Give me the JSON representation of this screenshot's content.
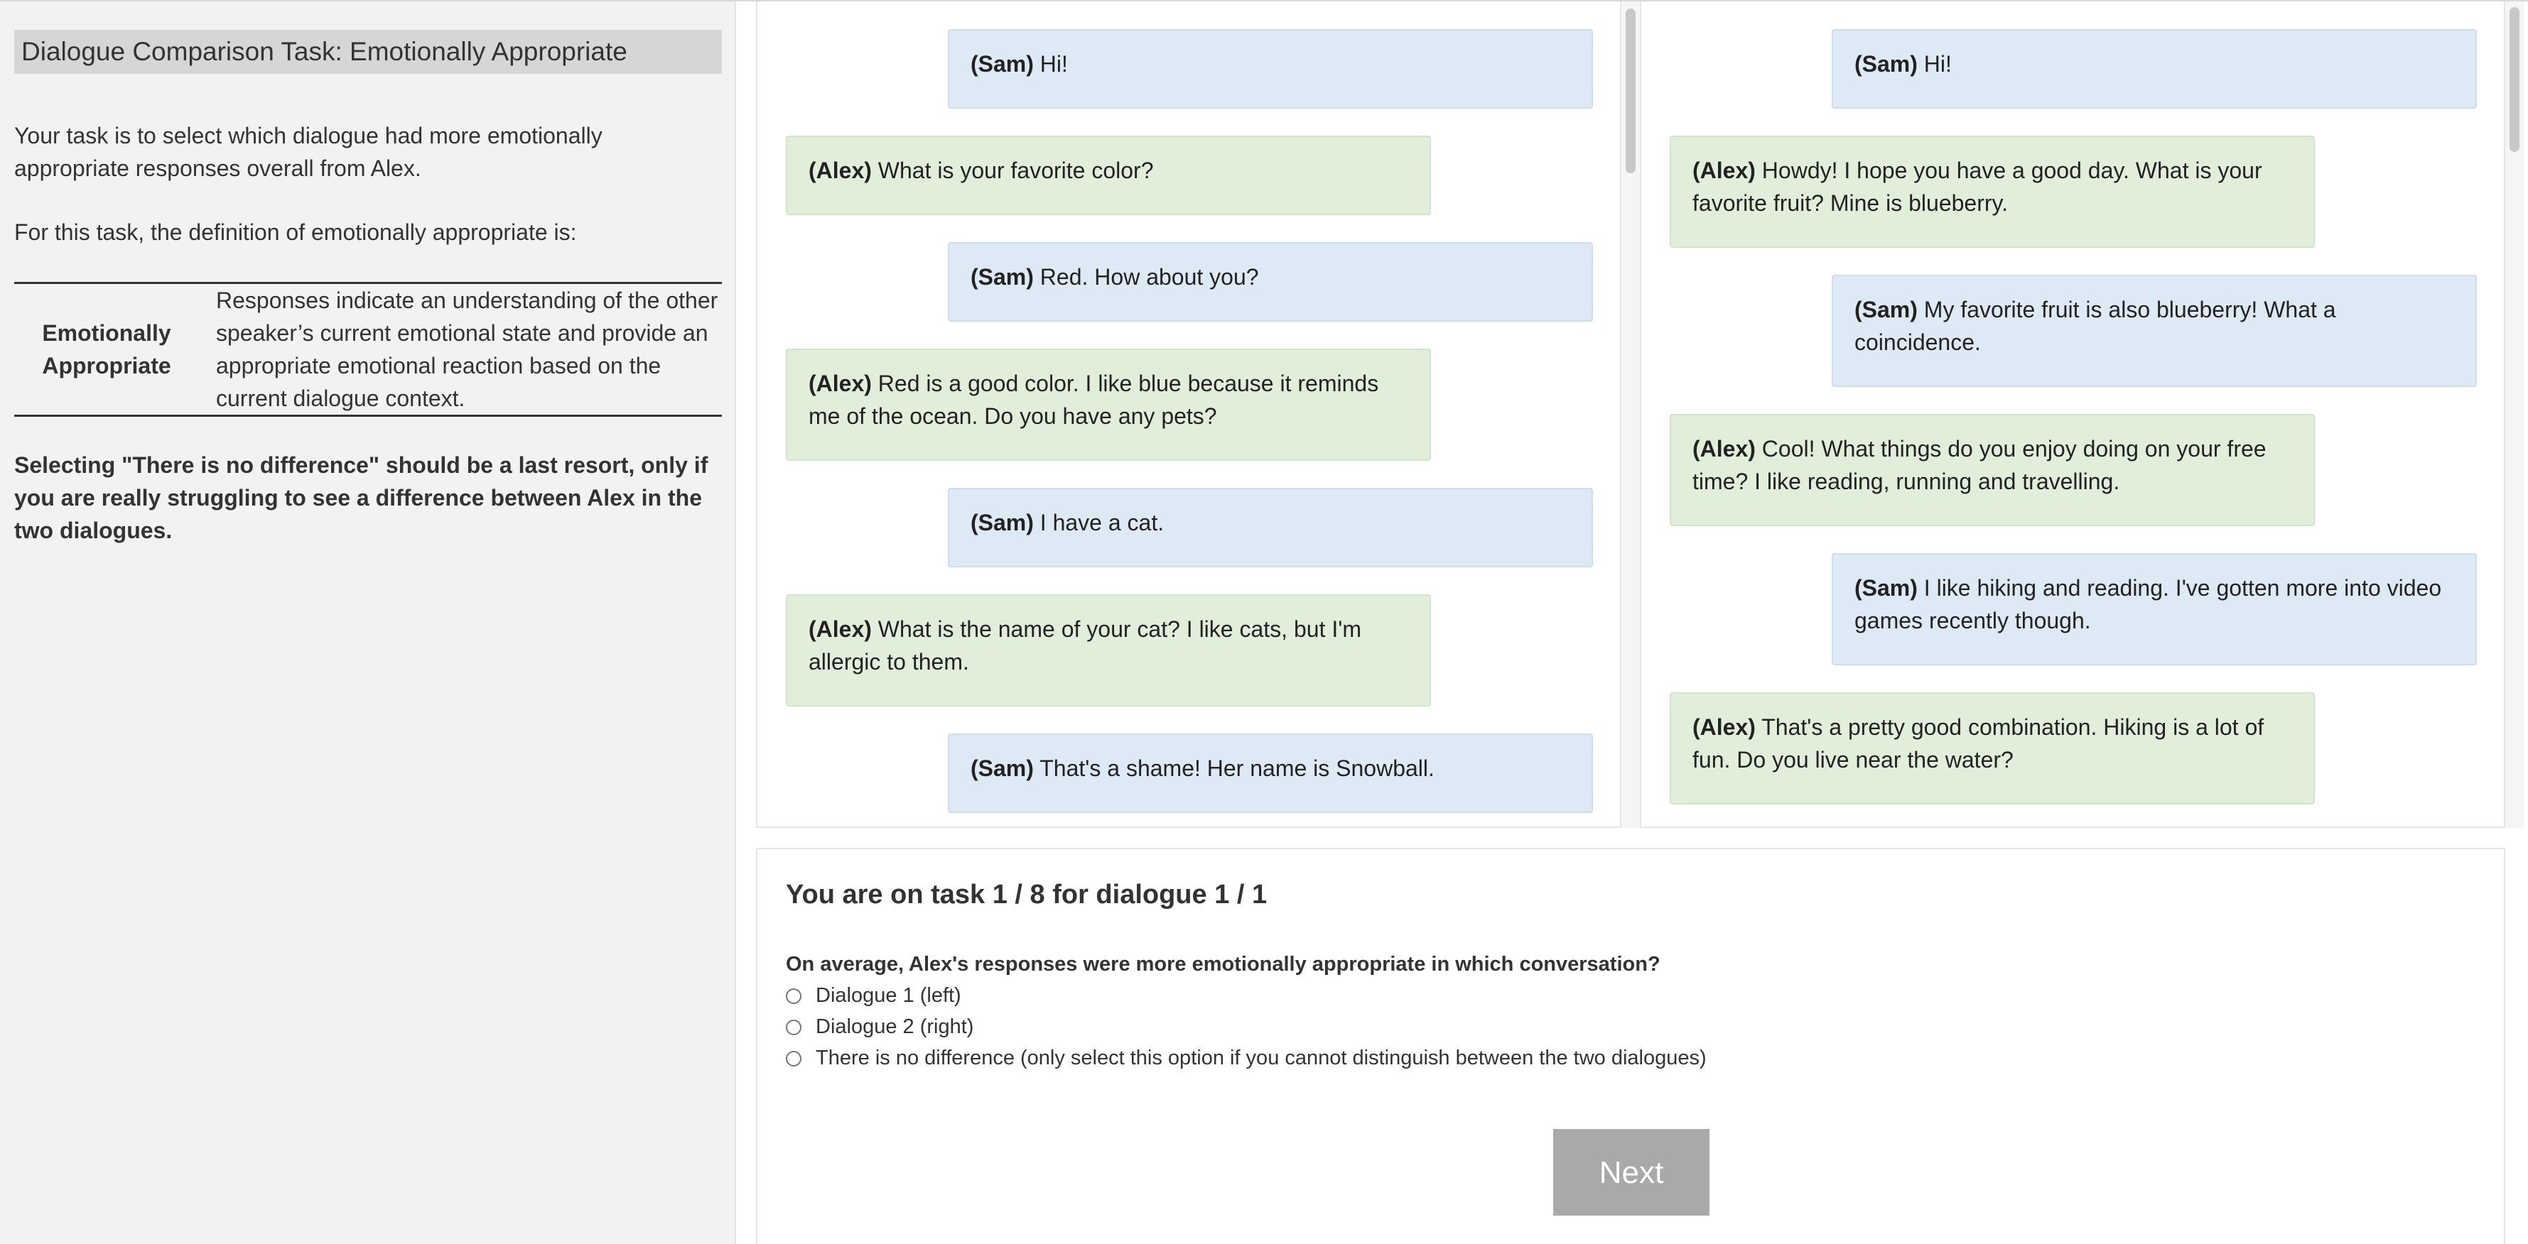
{
  "instructions": {
    "title": "Dialogue Comparison Task: Emotionally Appropriate",
    "intro": "Your task is to select which dialogue had more emotionally appropriate responses overall from Alex.",
    "definition_lead": "For this task, the definition of emotionally appropriate is:",
    "definition": {
      "term": "Emotionally Appropriate",
      "description": "Responses indicate an understanding of the other speaker’s current emotional state and provide an appropriate emotional reaction based on the current dialogue context."
    },
    "warning": "Selecting \"There is no difference\" should be a last resort, only if you are really struggling to see a difference between Alex in the two dialogues."
  },
  "dialogue1": {
    "messages": [
      {
        "speaker": "(Sam)",
        "text": "Hi!"
      },
      {
        "speaker": "(Alex)",
        "text": "What is your favorite color?"
      },
      {
        "speaker": "(Sam)",
        "text": "Red. How about you?"
      },
      {
        "speaker": "(Alex)",
        "text": "Red is a good color. I like blue because it reminds me of the ocean. Do you have any pets?"
      },
      {
        "speaker": "(Sam)",
        "text": "I have a cat."
      },
      {
        "speaker": "(Alex)",
        "text": "What is the name of your cat? I like cats, but I'm allergic to them."
      },
      {
        "speaker": "(Sam)",
        "text": "That's a shame! Her name is Snowball."
      }
    ]
  },
  "dialogue2": {
    "messages": [
      {
        "speaker": "(Sam)",
        "text": "Hi!"
      },
      {
        "speaker": "(Alex)",
        "text": "Howdy! I hope you have a good day. What is your favorite fruit? Mine is blueberry."
      },
      {
        "speaker": "(Sam)",
        "text": "My favorite fruit is also blueberry! What a coincidence."
      },
      {
        "speaker": "(Alex)",
        "text": "Cool! What things do you enjoy doing on your free time? I like reading, running and travelling."
      },
      {
        "speaker": "(Sam)",
        "text": "I like hiking and reading. I've gotten more into video games recently though."
      },
      {
        "speaker": "(Alex)",
        "text": "That's a pretty good combination. Hiking is a lot of fun. Do you live near the water?"
      }
    ]
  },
  "task": {
    "progress": "You are on task 1 / 8 for dialogue 1 / 1",
    "question": "On average, Alex's responses were more emotionally appropriate in which conversation?",
    "options": [
      "Dialogue 1 (left)",
      "Dialogue 2 (right)",
      "There is no difference (only select this option if you cannot distinguish between the two dialogues)"
    ],
    "next_label": "Next"
  }
}
